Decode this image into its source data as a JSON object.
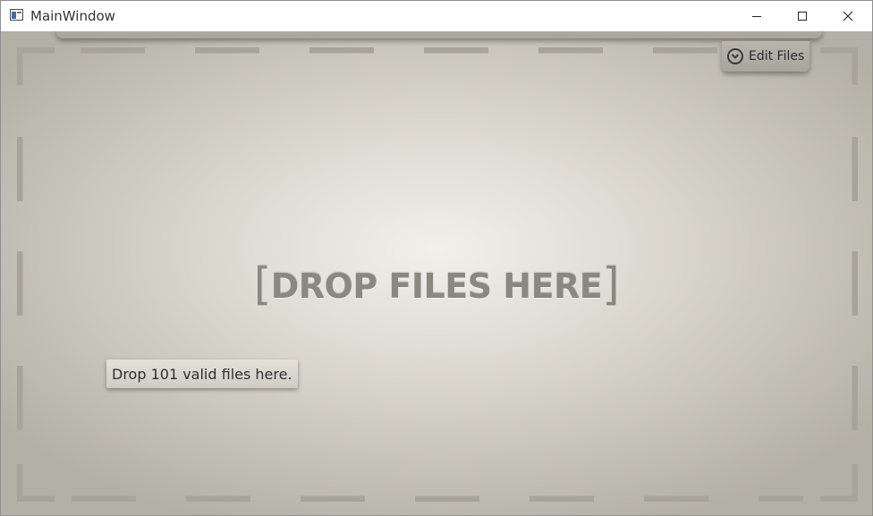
{
  "window": {
    "title": "MainWindow",
    "icon": "app-window-icon",
    "controls": [
      "minimize-icon",
      "maximize-icon",
      "close-icon"
    ]
  },
  "toolbar": {
    "edit_files_label": "Edit Files",
    "edit_files_icon": "chevron-down-circle-icon"
  },
  "drop_zone": {
    "open_bracket": "[",
    "title": "DROP FILES HERE",
    "close_bracket": "]",
    "status_text": "Drop 101 valid files here."
  },
  "colors": {
    "background_center": "#f2f0ea",
    "background_edge": "#b3b0a6",
    "dash_border": "#a7a49b",
    "drop_title": "#8b8880"
  }
}
